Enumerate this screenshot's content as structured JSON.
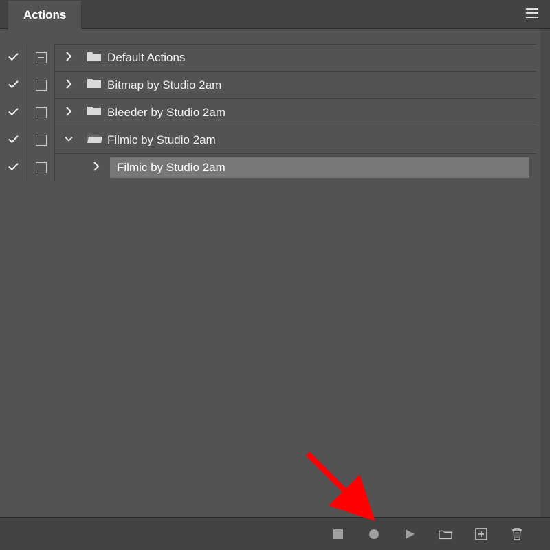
{
  "panel": {
    "title": "Actions"
  },
  "rows": [
    {
      "label": "Default Actions",
      "expanded": false,
      "dialog": "minus",
      "folder": "closed"
    },
    {
      "label": "Bitmap by Studio 2am",
      "expanded": false,
      "dialog": "empty",
      "folder": "closed"
    },
    {
      "label": "Bleeder by Studio 2am",
      "expanded": false,
      "dialog": "empty",
      "folder": "closed"
    },
    {
      "label": "Filmic by Studio 2am",
      "expanded": true,
      "dialog": "empty",
      "folder": "open"
    }
  ],
  "child": {
    "label": "Filmic by Studio 2am",
    "selected": true
  },
  "footer": {
    "stop_label": "Stop",
    "record_label": "Record",
    "play_label": "Play",
    "newset_label": "New Set",
    "new_label": "New Action",
    "trash_label": "Delete"
  }
}
